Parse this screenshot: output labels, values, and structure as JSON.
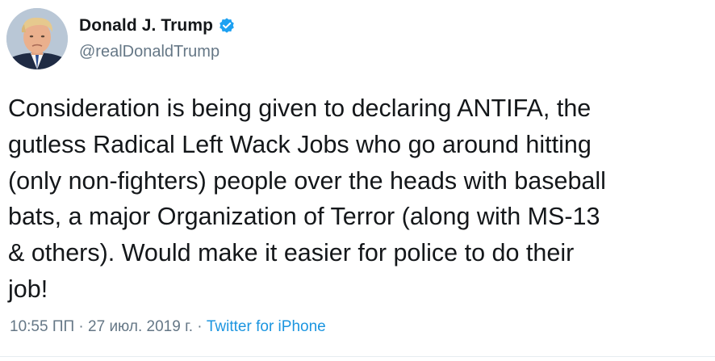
{
  "author": {
    "display_name": "Donald J. Trump",
    "handle": "@realDonaldTrump",
    "verified": true,
    "verified_icon": "verified-badge-icon"
  },
  "tweet": {
    "text": "Consideration is being given to declaring ANTIFA, the\ngutless Radical Left Wack Jobs who go around hitting\n(only non-fighters) people over the heads with baseball\nbats, a major Organization of Terror (along with MS-13\n& others). Would make it easier for police to do their\njob!",
    "time": "10:55 ПП",
    "separator": " · ",
    "date": "27 июл. 2019 г.",
    "source": "Twitter for iPhone"
  },
  "colors": {
    "text": "#14171a",
    "secondary": "#657786",
    "link": "#1b95e0",
    "verified": "#1da1f2"
  }
}
